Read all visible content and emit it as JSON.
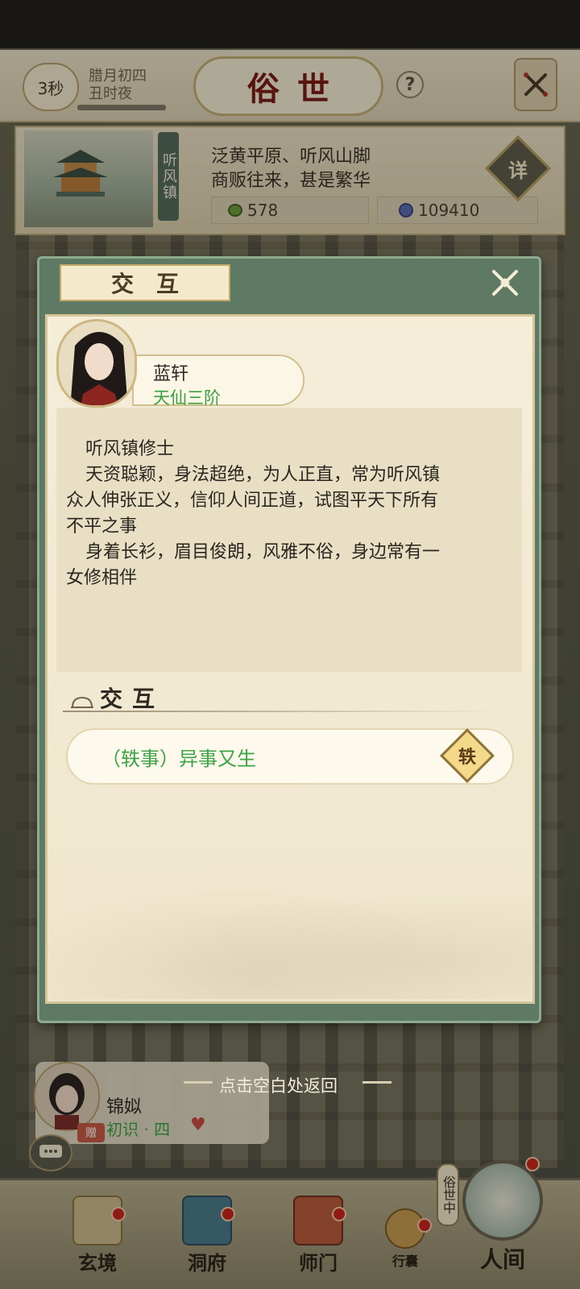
{
  "header": {
    "timer": "3秒",
    "date_line1": "腊月初四",
    "date_line2": "丑时夜",
    "title": "俗世",
    "help": "?"
  },
  "location": {
    "name": "听风镇",
    "desc_line1": "泛黄平原、听风山脚",
    "desc_line2": "商贩往来，甚是繁华",
    "resource1": "578",
    "resource2": "109410",
    "detail_label": "详"
  },
  "modal": {
    "title": "交互",
    "character": {
      "name": "蓝轩",
      "rank": "天仙三阶"
    },
    "description": {
      "title": "听风镇修士",
      "p1a": "天资聪颖，身法超绝，为人正直，常为听风镇",
      "p1b": "众人伸张正义，信仰人间正道，试图平天下所有",
      "p1c": "不平之事",
      "p2a": "身着长衫，眉目俊朗，风雅不俗，身边常有一",
      "p2b": "女修相伴"
    },
    "section_title": "交互",
    "options": [
      {
        "label": "（轶事）异事又生",
        "badge": "轶"
      }
    ]
  },
  "return_hint": "点击空白处返回",
  "npc": {
    "name": "锦姒",
    "level": "初识 · 四",
    "tag": "赠"
  },
  "bottom_nav": {
    "xuanjing": "玄境",
    "dongfu": "洞府",
    "shimen": "师门",
    "xingnang": "行囊",
    "renjian": "人间",
    "renjian_tag": "俗世中"
  },
  "colors": {
    "modal_frame": "#5f7a64",
    "parchment": "#f4edd8",
    "rank_green": "#3aa142",
    "title_red": "#7a1d14"
  }
}
